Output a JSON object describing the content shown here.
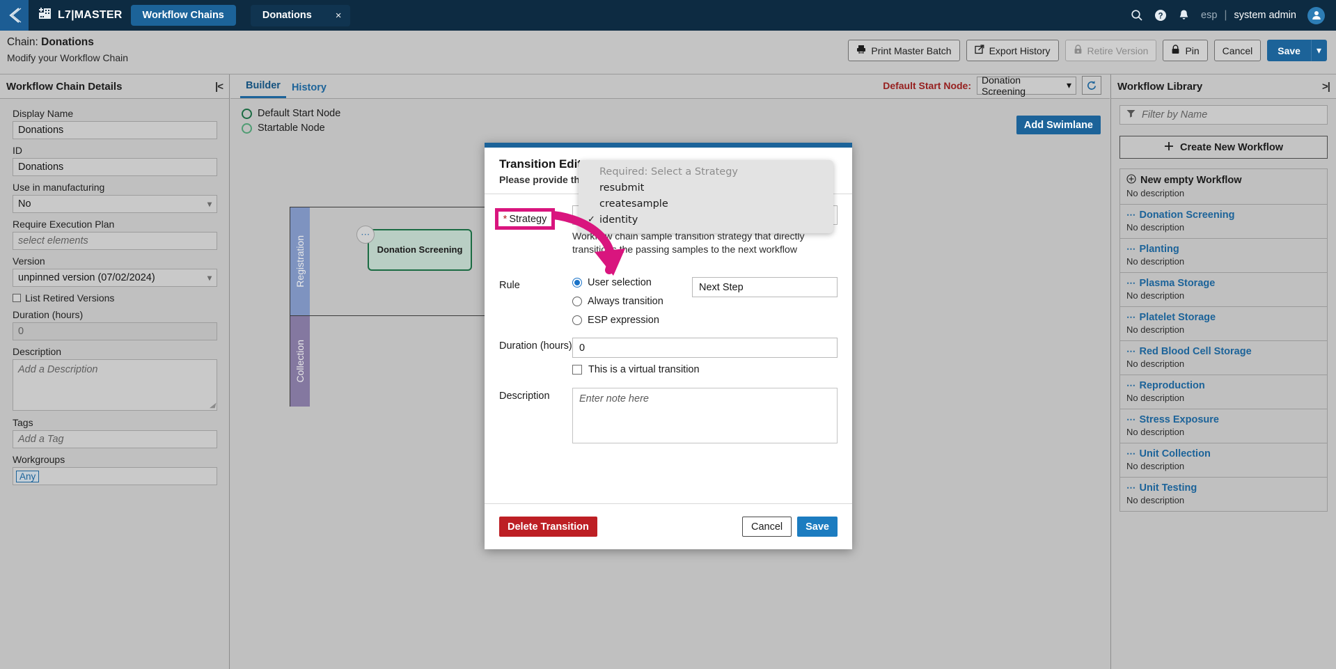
{
  "topnav": {
    "back_icon": "back-chevron-icon",
    "brand": "L7|MASTER",
    "brand_icon": "building-add-icon",
    "tabs": [
      {
        "label": "Workflow Chains",
        "active": true
      },
      {
        "label": "Donations",
        "active": false,
        "closable": true,
        "close": "×"
      }
    ],
    "search_icon": "search-icon",
    "help_icon": "help-circle-icon",
    "bell_icon": "bell-icon",
    "locale": "esp",
    "separator": "|",
    "user": "system admin",
    "avatar_icon": "user-avatar-icon"
  },
  "pageheader": {
    "title_prefix": "Chain: ",
    "title": "Donations",
    "subtitle": "Modify your Workflow Chain",
    "actions": [
      {
        "label": "Print Master Batch",
        "icon": "printer-icon",
        "disabled": false
      },
      {
        "label": "Export History",
        "icon": "external-link-icon",
        "disabled": false
      },
      {
        "label": "Retire Version",
        "icon": "lock-down-icon",
        "disabled": true
      },
      {
        "label": "Pin",
        "icon": "lock-icon",
        "disabled": false
      },
      {
        "label": "Cancel",
        "icon": "",
        "disabled": false
      }
    ],
    "save_label": "Save",
    "save_caret": "▾"
  },
  "leftpanel": {
    "title": "Workflow Chain Details",
    "collapse_icon": "collapse-left-icon",
    "fields": {
      "display_name_label": "Display Name",
      "display_name_value": "Donations",
      "id_label": "ID",
      "id_value": "Donations",
      "use_in_manufacturing_label": "Use in manufacturing",
      "use_in_manufacturing_value": "No",
      "require_execution_plan_label": "Require Execution Plan",
      "require_execution_plan_placeholder": "select elements",
      "version_label": "Version",
      "version_value": "unpinned version (07/02/2024)",
      "list_retired_label": "List Retired Versions",
      "duration_label": "Duration (hours)",
      "duration_value": "0",
      "description_label": "Description",
      "description_placeholder": "Add a Description",
      "tags_label": "Tags",
      "tags_placeholder": "Add a Tag",
      "workgroups_label": "Workgroups",
      "workgroups_chip": "Any"
    }
  },
  "center": {
    "tabs": [
      {
        "label": "Builder",
        "active": true
      },
      {
        "label": "History",
        "active": false
      }
    ],
    "start_node_label": "Default Start Node:",
    "start_node_value": "Donation Screening",
    "refresh_icon": "refresh-icon",
    "legend": [
      {
        "label": "Default Start Node"
      },
      {
        "label": "Startable Node"
      }
    ],
    "add_swimlane_label": "Add Swimlane",
    "swimlanes": [
      {
        "label": "Registration"
      },
      {
        "label": "Collection"
      }
    ],
    "node_label": "Donation Screening",
    "node_menu_icon": "dots-menu-icon"
  },
  "rightpanel": {
    "title": "Workflow Library",
    "collapse_icon": "collapse-right-icon",
    "filter_icon": "filter-icon",
    "filter_placeholder": "Filter by Name",
    "create_label": "Create New Workflow",
    "create_icon": "plus-icon",
    "items": [
      {
        "name": "New empty Workflow",
        "desc": "No description",
        "icon": "plus-circle-icon",
        "link": false
      },
      {
        "name": "Donation Screening",
        "desc": "No description",
        "icon": "dots-icon",
        "link": true
      },
      {
        "name": "Planting",
        "desc": "No description",
        "icon": "dots-icon",
        "link": true
      },
      {
        "name": "Plasma Storage",
        "desc": "No description",
        "icon": "dots-icon",
        "link": true
      },
      {
        "name": "Platelet Storage",
        "desc": "No description",
        "icon": "dots-icon",
        "link": true
      },
      {
        "name": "Red Blood Cell Storage",
        "desc": "No description",
        "icon": "dots-icon",
        "link": true
      },
      {
        "name": "Reproduction",
        "desc": "No description",
        "icon": "dots-icon",
        "link": true
      },
      {
        "name": "Stress Exposure",
        "desc": "No description",
        "icon": "dots-icon",
        "link": true
      },
      {
        "name": "Unit Collection",
        "desc": "No description",
        "icon": "dots-icon",
        "link": true
      },
      {
        "name": "Unit Testing",
        "desc": "No description",
        "icon": "dots-icon",
        "link": true
      }
    ]
  },
  "modal": {
    "title": "Transition Editor",
    "subtitle": "Please provide the following",
    "strategy_label": "Strategy",
    "strategy_required_mark": "*",
    "strategy_help": "Workflow chain sample transition strategy that directly transitions the passing samples to the next workflow",
    "rule_label": "Rule",
    "rule_options": [
      {
        "label": "User selection",
        "selected": true
      },
      {
        "label": "Always transition",
        "selected": false
      },
      {
        "label": "ESP expression",
        "selected": false
      }
    ],
    "rule_text_value": "Next Step",
    "duration_label": "Duration (hours)",
    "duration_value": "0",
    "virtual_label": "This is a virtual transition",
    "description_label": "Description",
    "description_placeholder": "Enter note here",
    "delete_label": "Delete Transition",
    "cancel_label": "Cancel",
    "save_label": "Save"
  },
  "dropdown": {
    "options": [
      {
        "label": "Required: Select a Strategy",
        "disabled": true,
        "checked": false
      },
      {
        "label": "resubmit",
        "disabled": false,
        "checked": false
      },
      {
        "label": "createsample",
        "disabled": false,
        "checked": false
      },
      {
        "label": "identity",
        "disabled": false,
        "checked": true
      }
    ],
    "check_glyph": "✓"
  },
  "annotation": {
    "label": "Strategy",
    "required_mark": "*",
    "color": "#d9157e"
  },
  "colors": {
    "nav_bg": "#0d2b42",
    "accent_blue": "#1c6399",
    "danger_red": "#bd1f24",
    "annotation_pink": "#d9157e",
    "node_green": "#1b6b43",
    "swimlane_1": "#7e93c0",
    "swimlane_2": "#8478a0"
  }
}
